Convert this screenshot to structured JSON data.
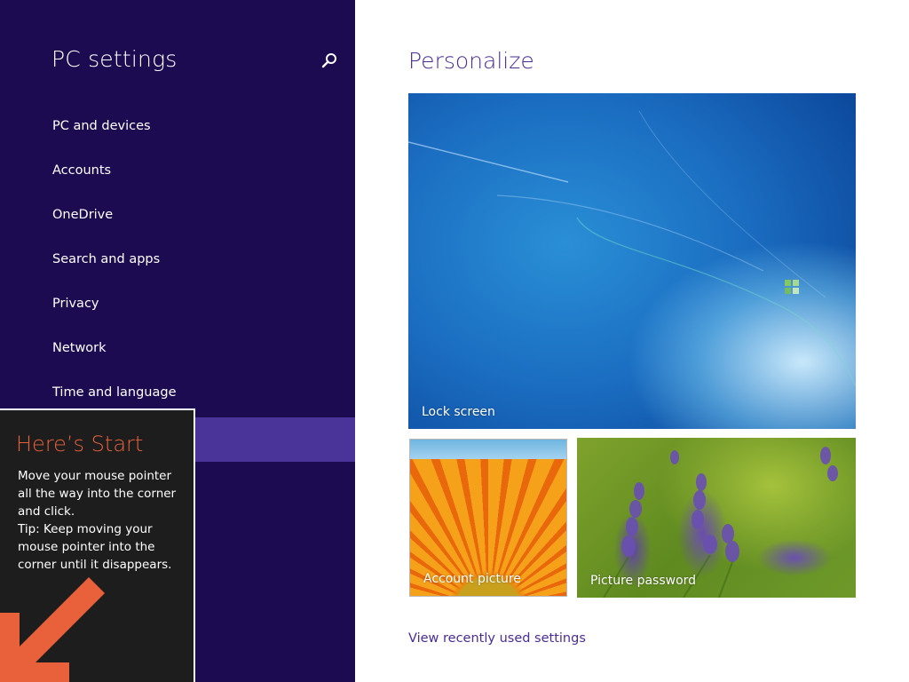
{
  "nav": {
    "title": "PC settings",
    "search_icon": "search-icon",
    "items": [
      {
        "label": "PC and devices"
      },
      {
        "label": "Accounts"
      },
      {
        "label": "OneDrive"
      },
      {
        "label": "Search and apps"
      },
      {
        "label": "Privacy"
      },
      {
        "label": "Network"
      },
      {
        "label": "Time and language"
      },
      {
        "label": "",
        "selected": true
      }
    ],
    "background_color": "#1c0b50",
    "selected_color": "#4a3499"
  },
  "main": {
    "heading": "Personalize",
    "tiles": {
      "lock_screen": {
        "label": "Lock screen"
      },
      "account_picture": {
        "label": "Account picture"
      },
      "picture_password": {
        "label": "Picture password"
      }
    },
    "recent_link": "View recently used settings",
    "accent_color": "#4b2c95"
  },
  "start_tip": {
    "title": "Here’s Start",
    "lines": [
      "Move your mouse pointer",
      "all the way into the corner",
      "and click.",
      "Tip: Keep moving your",
      "mouse pointer into the",
      "corner until it disappears."
    ],
    "arrow_icon": "arrow-down-left-icon",
    "title_color": "#e8613a"
  }
}
